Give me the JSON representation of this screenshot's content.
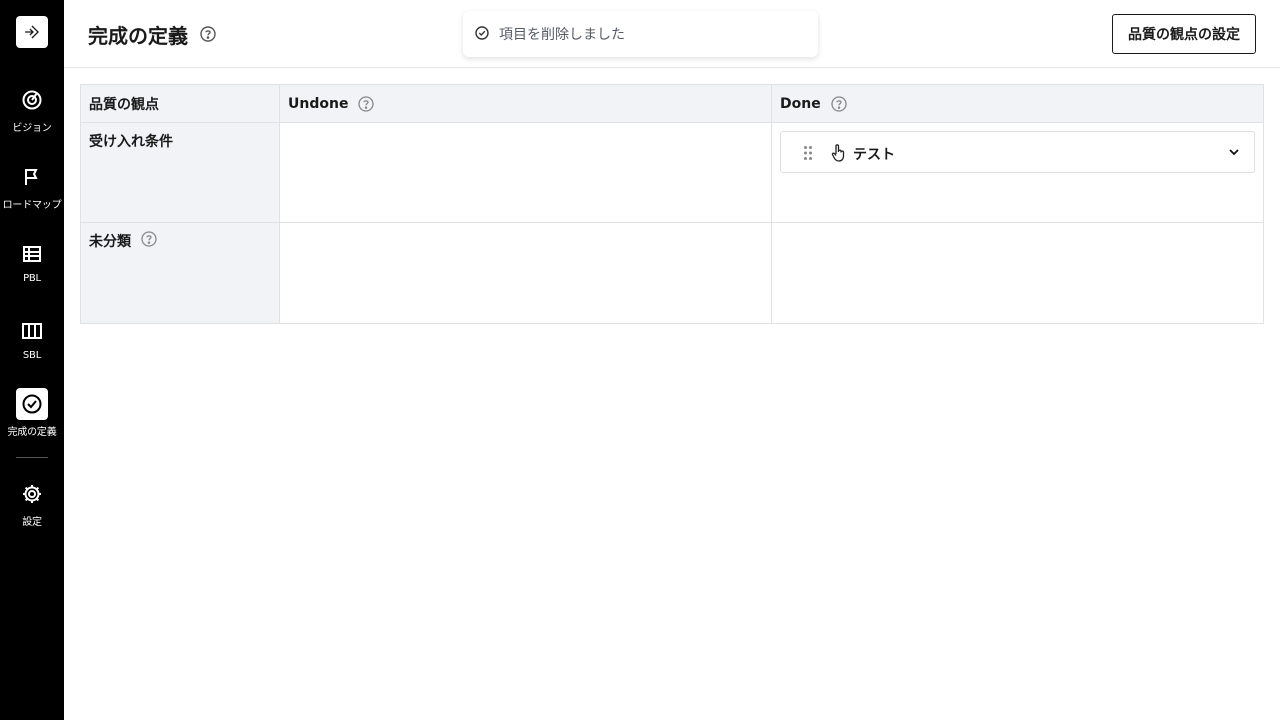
{
  "sidebar": {
    "logo_icon": "app-logo-icon",
    "items": [
      {
        "label": "ビジョン",
        "icon": "target-icon",
        "active": false
      },
      {
        "label": "ロードマップ",
        "icon": "flag-icon",
        "active": false
      },
      {
        "label": "PBL",
        "icon": "list-icon",
        "active": false
      },
      {
        "label": "SBL",
        "icon": "columns-icon",
        "active": false
      },
      {
        "label": "完成の定義",
        "icon": "check-circle-icon",
        "active": true
      },
      {
        "label": "設定",
        "icon": "gear-icon",
        "active": false
      }
    ]
  },
  "header": {
    "title": "完成の定義",
    "settings_button": "品質の観点の設定"
  },
  "toast": {
    "message": "項目を削除しました",
    "icon": "check-circle-icon"
  },
  "table": {
    "columns": [
      "品質の観点",
      "Undone",
      "Done"
    ],
    "rows": [
      {
        "label": "受け入れ条件",
        "undone": [],
        "done": [
          {
            "text": "テスト",
            "icon": "hand-pointer-icon"
          }
        ]
      },
      {
        "label": "未分類",
        "undone": [],
        "done": []
      }
    ]
  },
  "colors": {
    "sidebar_bg": "#000000",
    "header_cell_bg": "#f2f3f6",
    "border": "#dfe1e5"
  }
}
